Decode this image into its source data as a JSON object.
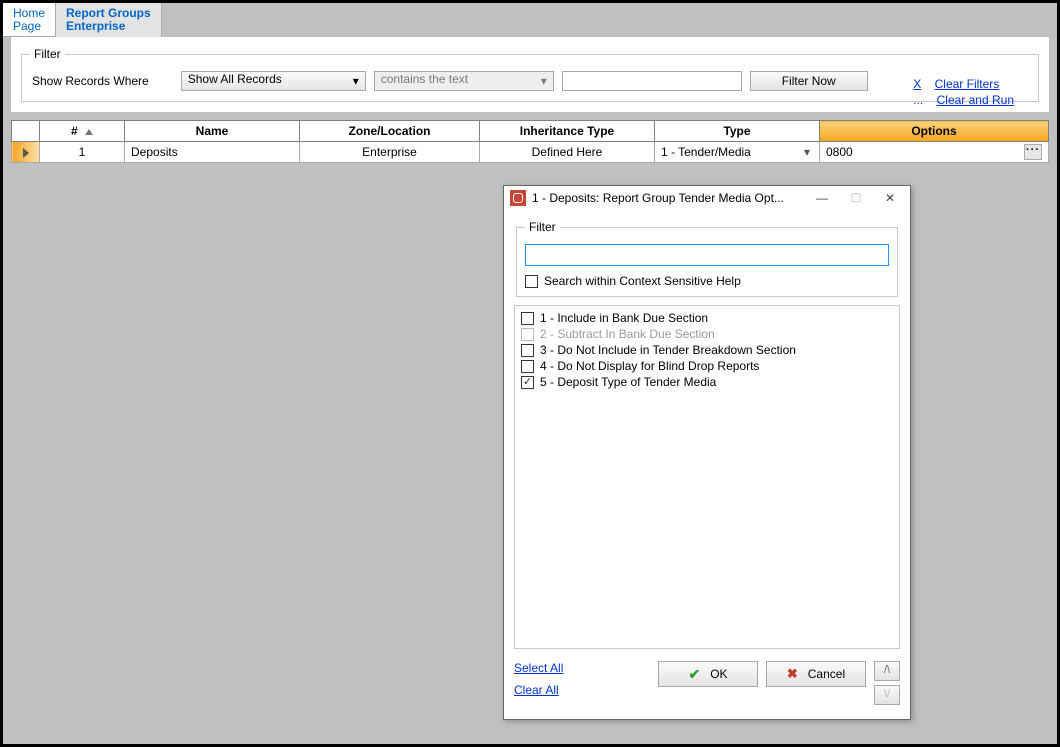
{
  "tabs": {
    "home": "Home\nPage",
    "active": "Report Groups\nEnterprise"
  },
  "filterBar": {
    "legend": "Filter",
    "label": "Show Records Where",
    "select1": "Show All Records",
    "select2": "contains the text",
    "button": "Filter Now",
    "linkX": "X",
    "linkDots": "...",
    "link1": "Clear Filters",
    "link2": "Clear and Run"
  },
  "grid": {
    "headers": {
      "num": "#",
      "name": "Name",
      "zone": "Zone/Location",
      "inh": "Inheritance Type",
      "type": "Type",
      "opts": "Options"
    },
    "row": {
      "num": "1",
      "name": "Deposits",
      "zone": "Enterprise",
      "inh": "Defined Here",
      "type": "1 - Tender/Media",
      "opts": "0800"
    }
  },
  "dialog": {
    "title": "1 - Deposits: Report Group Tender Media Opt...",
    "filterLegend": "Filter",
    "searchChk": "Search within Context Sensitive Help",
    "items": [
      {
        "label": "1 - Include in Bank Due Section",
        "checked": false,
        "disabled": false
      },
      {
        "label": "2 - Subtract In Bank Due Section",
        "checked": false,
        "disabled": true
      },
      {
        "label": "3 - Do Not Include in Tender Breakdown Section",
        "checked": false,
        "disabled": false
      },
      {
        "label": "4 - Do Not Display for Blind Drop Reports",
        "checked": false,
        "disabled": false
      },
      {
        "label": "5 - Deposit Type of Tender Media",
        "checked": true,
        "disabled": false
      }
    ],
    "selectAll": "Select All",
    "clearAll": "Clear All",
    "ok": "OK",
    "cancel": "Cancel",
    "up": "/\\",
    "down": "\\/"
  }
}
